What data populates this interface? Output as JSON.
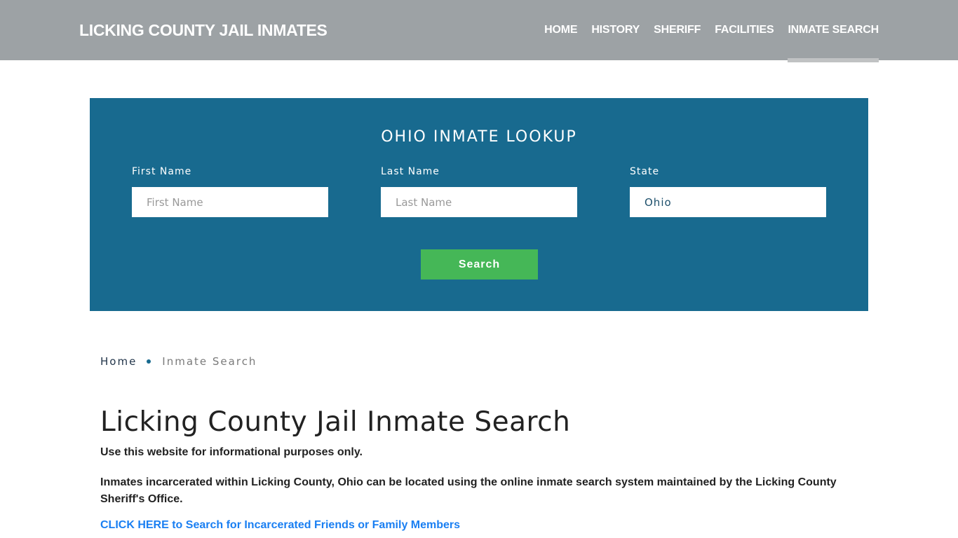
{
  "header": {
    "brand": "LICKING COUNTY JAIL INMATES",
    "nav": [
      {
        "label": "HOME",
        "active": false
      },
      {
        "label": "HISTORY",
        "active": false
      },
      {
        "label": "SHERIFF",
        "active": false
      },
      {
        "label": "FACILITIES",
        "active": false
      },
      {
        "label": "INMATE SEARCH",
        "active": true
      }
    ]
  },
  "lookup": {
    "title": "OHIO INMATE LOOKUP",
    "first_name": {
      "label": "First Name",
      "placeholder": "First Name",
      "value": ""
    },
    "last_name": {
      "label": "Last Name",
      "placeholder": "Last Name",
      "value": ""
    },
    "state": {
      "label": "State",
      "value": "Ohio"
    },
    "search_label": "Search",
    "colors": {
      "panel": "#186a8f",
      "button": "#45b757"
    }
  },
  "breadcrumb": {
    "home": "Home",
    "current": "Inmate Search"
  },
  "content": {
    "title": "Licking County Jail Inmate Search",
    "disclaimer": "Use this website for informational purposes only.",
    "description": "Inmates incarcerated within Licking County, Ohio can be located using the online inmate search system maintained by the Licking County Sheriff's Office.",
    "cta_link": "CLICK HERE to Search for Incarcerated Friends or Family Members"
  }
}
